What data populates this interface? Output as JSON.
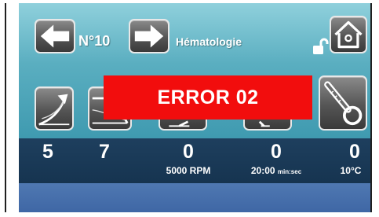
{
  "header": {
    "program_number": "N°10",
    "program_name": "Hématologie"
  },
  "toolbar": {
    "prev_icon": "arrow-left-icon",
    "next_icon": "arrow-right-icon",
    "lock_icon": "unlocked-padlock-icon",
    "home_icon": "home-icon"
  },
  "modes": [
    {
      "icon": "acceleration-ramp-icon"
    },
    {
      "icon": "deceleration-ramp-icon"
    },
    {
      "icon": "speed-icon"
    },
    {
      "icon": "timer-icon"
    },
    {
      "icon": "thermometer-icon"
    }
  ],
  "readouts": {
    "accel": "5",
    "decel": "7",
    "speed": "0",
    "speed_setpoint": "5000 RPM",
    "time": "0",
    "time_setpoint": "20:00",
    "time_unit": "min:sec",
    "temperature": "0",
    "temperature_setpoint": "10°C"
  },
  "alert": {
    "message": "ERROR 02",
    "color": "#f20d0d"
  },
  "colors": {
    "background_top": "#5aaec0",
    "readout_strip": "#1e3f5e",
    "bottom_bar": "#4f78b2"
  }
}
